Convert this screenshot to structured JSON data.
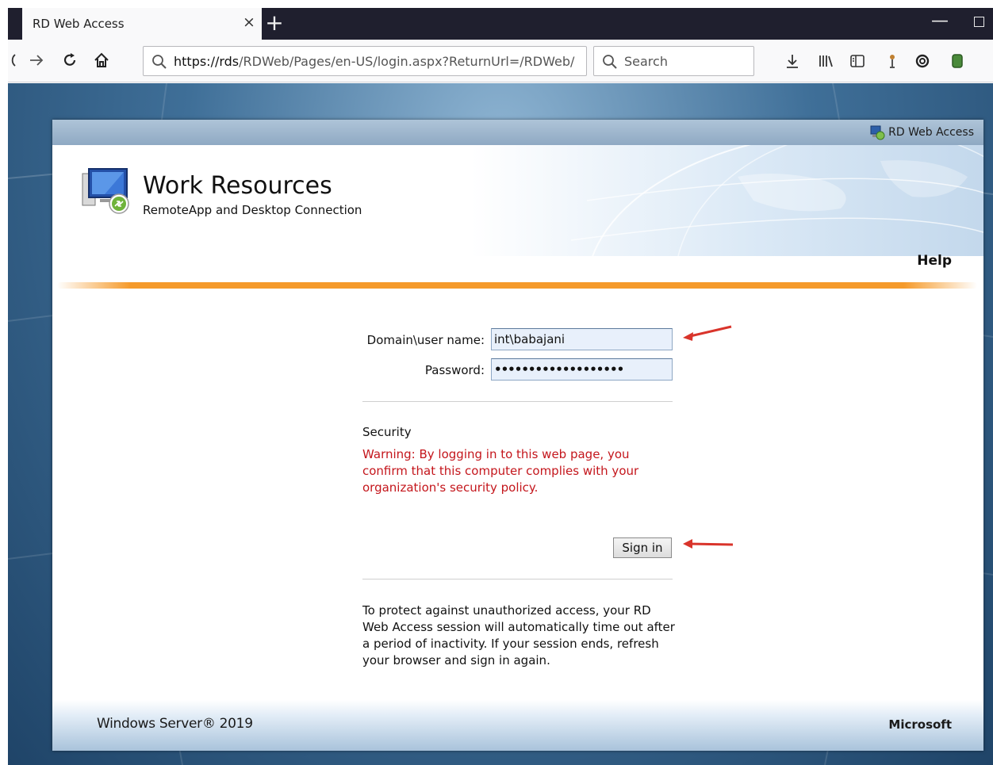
{
  "browser": {
    "tab_title": "RD Web Access",
    "tab_close": "×",
    "new_tab": "+",
    "url_host": "https://rds",
    "url_path": "/RDWeb/Pages/en-US/login.aspx?ReturnUrl=/RDWeb/",
    "search_placeholder": "Search",
    "minimize": "—",
    "icons": [
      "back-icon",
      "forward-icon",
      "reload-icon",
      "home-icon",
      "download-icon",
      "library-icon",
      "sidebar-icon",
      "extension-icon",
      "sync-icon",
      "addon-icon"
    ]
  },
  "page": {
    "topstrip_label": "RD Web Access",
    "title": "Work Resources",
    "subtitle": "RemoteApp and Desktop Connection",
    "help": "Help",
    "form": {
      "username_label": "Domain\\user name:",
      "username_value": "int\\babajani",
      "password_label": "Password:",
      "password_value": "•••••••••••••••••••"
    },
    "security": {
      "title": "Security",
      "warning": "Warning: By logging in to this web page, you confirm that this computer complies with your organization's security policy."
    },
    "signin_label": "Sign in",
    "timeout_note": "To protect against unauthorized access, your RD Web Access session will automatically time out after a period of inactivity. If your session ends, refresh your browser and sign in again.",
    "footer_os": "Windows Server® 2019",
    "footer_brand": "Microsoft"
  },
  "colors": {
    "warning": "#c4161c",
    "accent_orange": "#f59a2a",
    "annotation_arrow": "#d9342b"
  }
}
